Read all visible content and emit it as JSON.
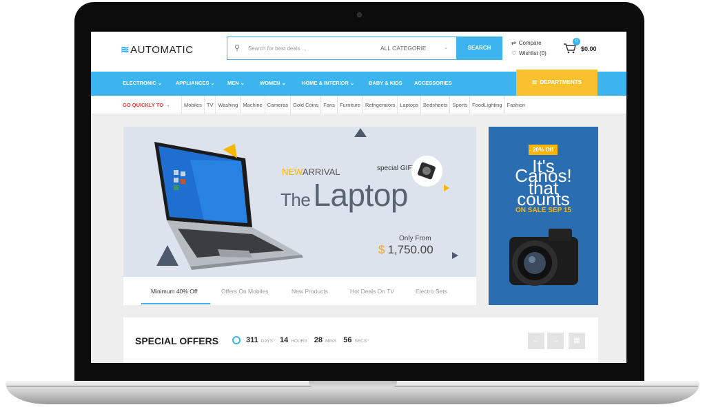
{
  "header": {
    "logo": "AUTOMATIC",
    "logo_mark": "≋",
    "search_placeholder": "Search for best deals ...",
    "category": "ALL CATEGORIE",
    "search_button": "SEARCH",
    "compare": "Compare",
    "wishlist": "Wishlist (0)",
    "cart_count": "0",
    "cart_total": "$0.00"
  },
  "nav": {
    "items": [
      "ELECTRONIC",
      "APPLIANCES",
      "MEN",
      "WOMEN",
      "HOME & INTERIOR",
      "BABY & KIDS",
      "ACCESSORIES"
    ],
    "departments": "DEPARTMENTS"
  },
  "quick": {
    "label": "GO QUICKLY TO",
    "links": [
      "Mobiles",
      "TV",
      "Washing",
      "Machine",
      "Cameras",
      "Gold Coins",
      "Fans",
      "Furniture",
      "Refrigerators",
      "Laptops",
      "Bedsheets",
      "Sports",
      "FoodLighting",
      "Fashion"
    ]
  },
  "banner": {
    "new": "NEW",
    "arrival": "ARRIVAL",
    "the": "The",
    "product": "Laptop",
    "gift": "special GIFT",
    "only_from": "Only From",
    "currency": "$",
    "price": "1,750.00"
  },
  "tabs": [
    "Minimum 40% Off",
    "Offers On Mobiles",
    "New Products",
    "Hot Deals On TV",
    "Electro Sets"
  ],
  "ad": {
    "badge": "20% Off",
    "line1": "It's",
    "line2": "Canos!",
    "line3": "that",
    "line4": "counts",
    "sale": "ON SALE SEP 15"
  },
  "offers": {
    "title": "SPECIAL OFFERS",
    "days": "311",
    "days_label": "DAYS",
    "hours": "14",
    "hours_label": "HOURS",
    "mins": "28",
    "mins_label": "MINS",
    "secs": "56",
    "secs_label": "SECS"
  },
  "colors": {
    "accent": "#3cb5ee",
    "yellow": "#fbc02d",
    "red": "#e53935",
    "ad_blue": "#2a6db0"
  }
}
